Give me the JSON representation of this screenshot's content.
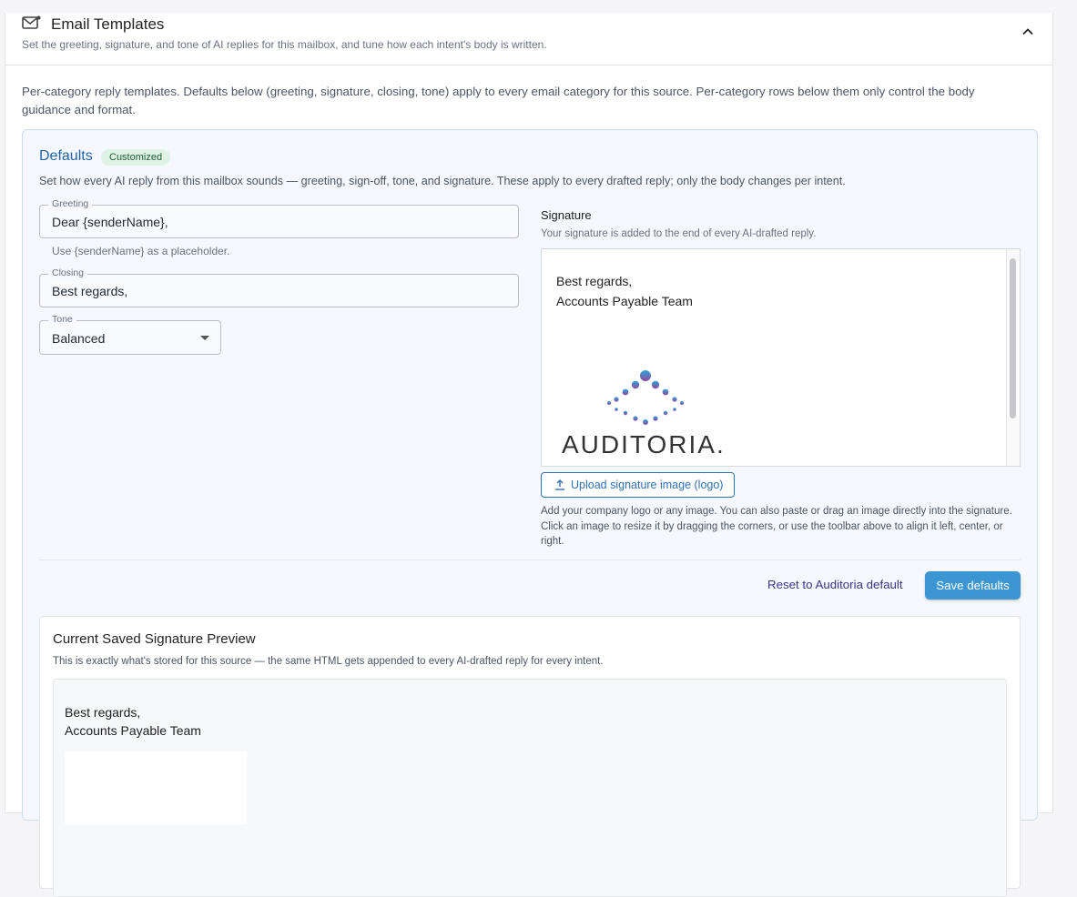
{
  "header": {
    "title": "Email Templates",
    "subtitle": "Set the greeting, signature, and tone of AI replies for this mailbox, and tune how each intent's body is written."
  },
  "intro": "Per-category reply templates. Defaults below (greeting, signature, closing, tone) apply to every email category for this source. Per-category rows below them only control the body guidance and format.",
  "defaults": {
    "title": "Defaults",
    "badge": "Customized",
    "description": "Set how every AI reply from this mailbox sounds — greeting, sign-off, tone, and signature. These apply to every drafted reply; only the body changes per intent.",
    "greeting": {
      "label": "Greeting",
      "value": "Dear {senderName},",
      "helper": "Use {senderName} as a placeholder."
    },
    "closing": {
      "label": "Closing",
      "value": "Best regards,"
    },
    "tone": {
      "label": "Tone",
      "value": "Balanced"
    },
    "signature": {
      "label": "Signature",
      "hint": "Your signature is added to the end of every AI-drafted reply.",
      "line1": "Best regards,",
      "line2": "Accounts Payable Team",
      "logo_text": "AUDITORIA.",
      "upload_label": "Upload signature image (logo)",
      "upload_hint": "Add your company logo or any image. You can also paste or drag an image directly into the signature. Click an image to resize it by dragging the corners, or use the toolbar above to align it left, center, or right."
    },
    "reset_label": "Reset to Auditoria default",
    "save_label": "Save defaults"
  },
  "preview": {
    "title": "Current Saved Signature Preview",
    "description": "This is exactly what's stored for this source — the same HTML gets appended to every AI-drafted reply for every intent.",
    "line1": "Best regards,",
    "line2": "Accounts Payable Team"
  },
  "colors": {
    "accent": "#2563a8",
    "save_button": "#3c96d1",
    "badge_bg": "#dff3e4",
    "logo_blue": "#2f9fd8",
    "logo_purple": "#8a4fa2"
  },
  "icons": {
    "header": "mail-icon",
    "collapse": "chevron-up-icon",
    "upload": "upload-icon",
    "tone_dropdown": "caret-down-icon"
  }
}
